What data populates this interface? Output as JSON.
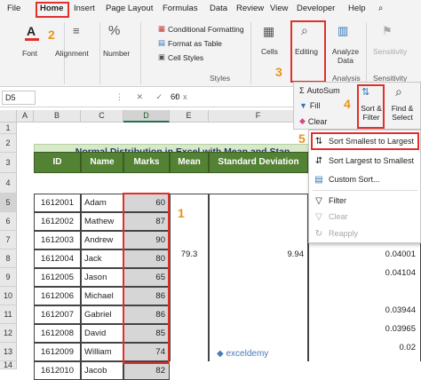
{
  "tabs": [
    "File",
    "Home",
    "Insert",
    "Page Layout",
    "Formulas",
    "Data",
    "Review",
    "View",
    "Developer",
    "Help"
  ],
  "ribbon": {
    "font": "Font",
    "alignment": "Alignment",
    "number": "Number",
    "styles_items": [
      "Conditional Formatting",
      "Format as Table",
      "Cell Styles"
    ],
    "styles_group": "Styles",
    "cells": "Cells",
    "editing": "Editing",
    "analyze": "Analyze Data",
    "analysis_group": "Analysis",
    "sensitivity": "Sensitivity",
    "sensitivity_group": "Sensitivity"
  },
  "badges": [
    "1",
    "2",
    "3",
    "4",
    "5"
  ],
  "formula_bar": {
    "name_box": "D5",
    "fx_icons": "⋮ ✕ ✓ fx",
    "value": "60"
  },
  "columns": [
    "A",
    "B",
    "C",
    "D",
    "E",
    "F"
  ],
  "rows": [
    "1",
    "2",
    "3",
    "4",
    "5",
    "6",
    "7",
    "8",
    "9",
    "10",
    "11",
    "12",
    "13",
    "14"
  ],
  "sheet": {
    "title": "Normal Distribution in Excel with Mean and Stan",
    "headers": [
      "ID",
      "Name",
      "Marks",
      "Mean",
      "Standard Deviation"
    ],
    "records": [
      {
        "id": "1612001",
        "name": "Adam",
        "marks": "60"
      },
      {
        "id": "1612002",
        "name": "Mathew",
        "marks": "87"
      },
      {
        "id": "1612003",
        "name": "Andrew",
        "marks": "90"
      },
      {
        "id": "1612004",
        "name": "Jack",
        "marks": "80"
      },
      {
        "id": "1612005",
        "name": "Jason",
        "marks": "65"
      },
      {
        "id": "1612006",
        "name": "Michael",
        "marks": "86"
      },
      {
        "id": "1612007",
        "name": "Gabriel",
        "marks": "86"
      },
      {
        "id": "1612008",
        "name": "David",
        "marks": "85"
      },
      {
        "id": "1612009",
        "name": "William",
        "marks": "74"
      },
      {
        "id": "1612010",
        "name": "Jacob",
        "marks": "82"
      }
    ],
    "mean": "79.3",
    "std_dev": "9.94",
    "distribution_values": [
      "0.04001",
      "0.04104",
      "0.03944",
      "0.03965",
      "0.02"
    ]
  },
  "edit_panel": {
    "autosum": "AutoSum",
    "fill": "Fill",
    "clear": "Clear",
    "sort_filter": "Sort & Filter",
    "find_select": "Find & Select"
  },
  "sort_menu": {
    "asc": "Sort Smallest to Largest",
    "desc": "Sort Largest to Smallest",
    "custom": "Custom Sort...",
    "filter": "Filter",
    "clear": "Clear",
    "reapply": "Reapply"
  },
  "watermark": "exceldemy",
  "colors": {
    "header_green": "#548235",
    "title_green": "#d8e9c9",
    "callout_red": "#e0302a",
    "badge_orange": "#e8941c"
  }
}
